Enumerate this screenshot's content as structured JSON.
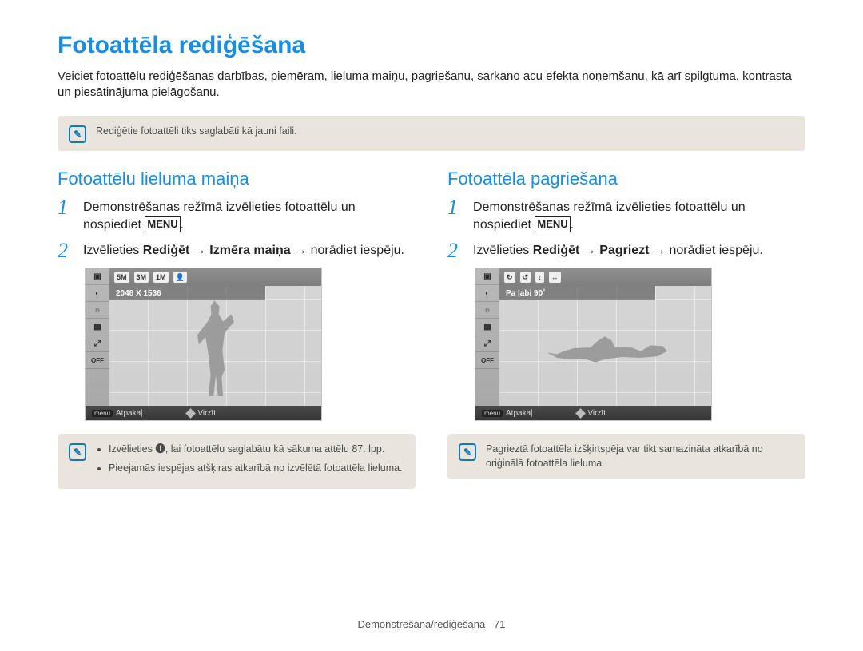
{
  "title": "Fotoattēla rediģēšana",
  "intro": "Veiciet fotoattēlu rediģēšanas darbības, piemēram, lieluma maiņu, pagriešanu, sarkano acu efekta noņemšanu, kā arī spilgtuma, kontrasta un piesātinājuma pielāgošanu.",
  "top_note": "Rediģētie fotoattēli tiks saglabāti kā jauni faili.",
  "left": {
    "heading": "Fotoattēlu lieluma maiņa",
    "step1_a": "Demonstrēšanas režīmā izvēlieties fotoattēlu un nospiediet ",
    "menu": "MENU",
    "step2_a": "Izvēlieties ",
    "step2_b": "Rediģēt",
    "step2_c": "Izmēra maiņa",
    "step2_d": " norādiet iespēju.",
    "lcd": {
      "pill1": "5M",
      "pill2": "3M",
      "pill3": "1M",
      "sub": "2048 X 1536",
      "back_lbl": "menu",
      "back": "Atpakaļ",
      "move": "Virzīt"
    },
    "note_items": [
      "Izvēlieties 🅘, lai fotoattēlu saglabātu kā sākuma attēlu 87. lpp.",
      "Pieejamās iespējas atšķiras atkarībā no izvēlētā fotoattēla lieluma."
    ]
  },
  "right": {
    "heading": "Fotoattēla pagriešana",
    "step1_a": "Demonstrēšanas režīmā izvēlieties fotoattēlu un nospiediet ",
    "menu": "MENU",
    "step2_a": "Izvēlieties ",
    "step2_b": "Rediģēt",
    "step2_c": "Pagriezt",
    "step2_d": " norādiet iespēju.",
    "lcd": {
      "sub": "Pa labi 90˚",
      "back_lbl": "menu",
      "back": "Atpakaļ",
      "move": "Virzīt"
    },
    "note": "Pagrieztā fotoattēla izšķirtspēja var tikt samazināta atkarībā no oriģinālā fotoattēla lieluma."
  },
  "footer_section": "Demonstrēšana/rediģēšana",
  "footer_page": "71"
}
